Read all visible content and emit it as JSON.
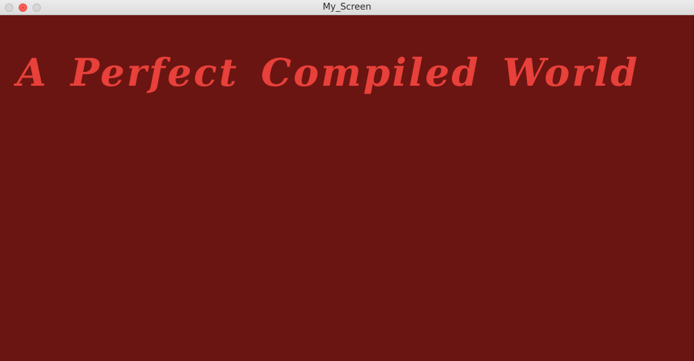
{
  "window": {
    "title": "My_Screen"
  },
  "content": {
    "headline": "A Perfect Compiled World"
  },
  "colors": {
    "background": "#6a1512",
    "headline": "#e8403a",
    "titlebar": "#e4e4e4"
  },
  "icons": {
    "close": "close-icon",
    "minimize": "minimize-icon",
    "zoom": "zoom-icon"
  }
}
